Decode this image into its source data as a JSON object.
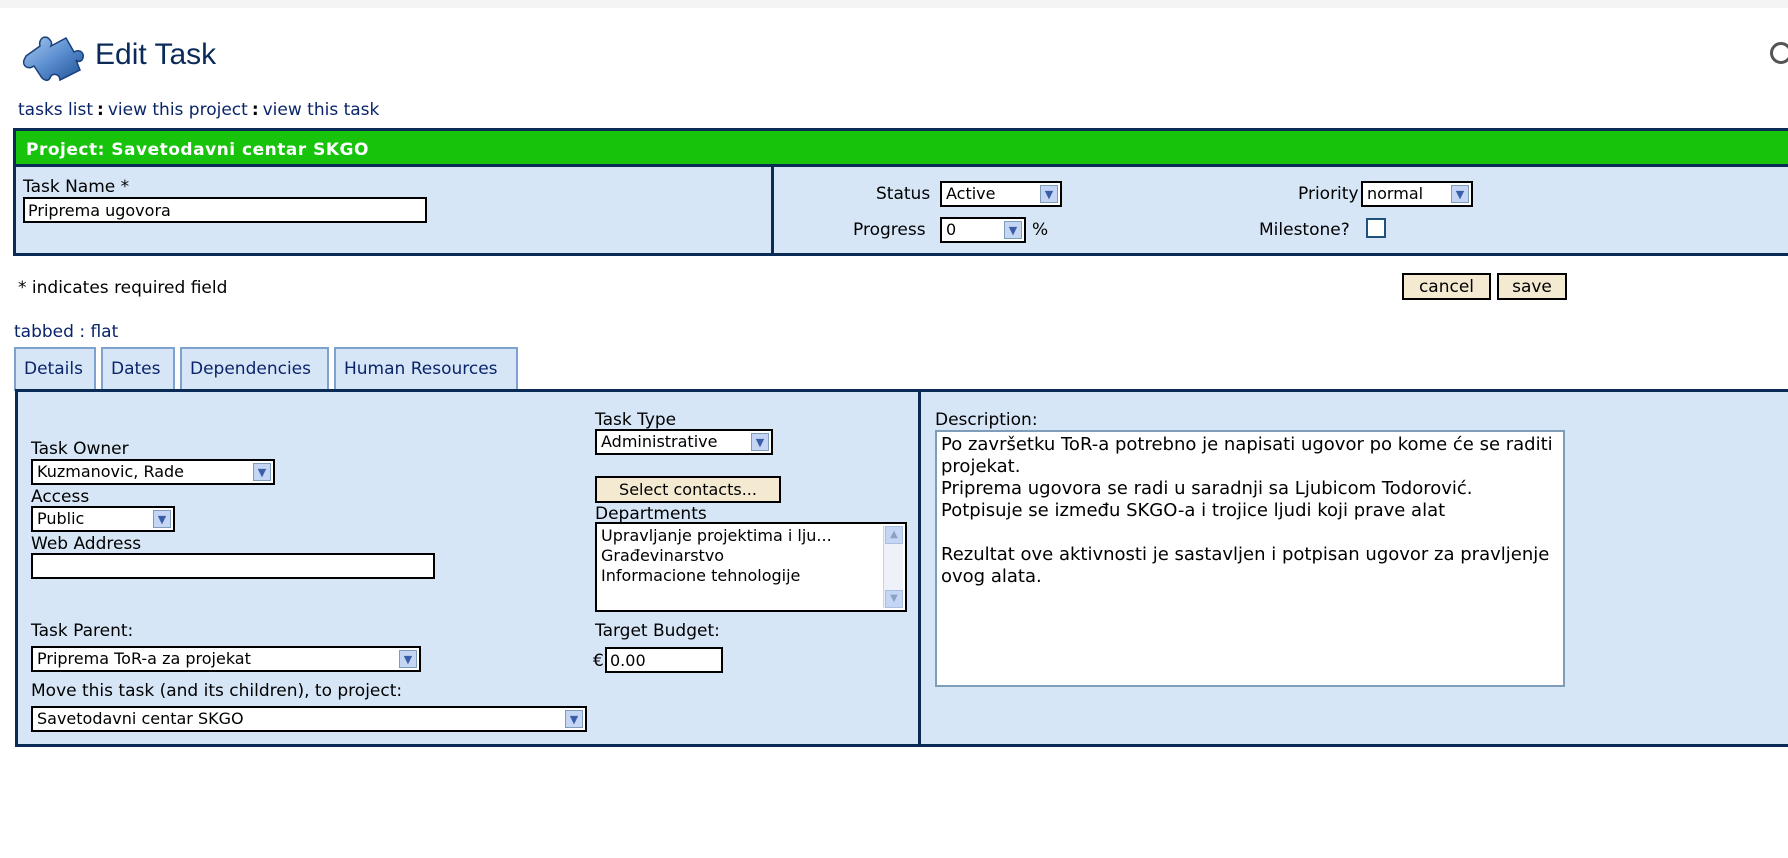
{
  "header": {
    "title": "Edit Task",
    "logo_icon": "puzzle-piece-icon"
  },
  "breadcrumbs": {
    "tasks_list": "tasks list",
    "sep1": ":",
    "view_project": "view this project",
    "sep2": ":",
    "view_task": "view this task"
  },
  "project": {
    "heading": "Project: Savetodavni centar SKGO",
    "task_name_label": "Task Name *",
    "task_name_value": "Priprema ugovora",
    "status_label": "Status",
    "status_value": "Active",
    "priority_label": "Priority *",
    "priority_value": "normal",
    "progress_label": "Progress",
    "progress_value": "0",
    "progress_unit": "%",
    "milestone_label": "Milestone?",
    "milestone_checked": false
  },
  "form": {
    "required_note": "* indicates required field",
    "cancel_label": "cancel",
    "save_label": "save"
  },
  "view_mode": {
    "tabbed": "tabbed",
    "sep": ":",
    "flat": "flat"
  },
  "tabs": [
    {
      "label": "Details",
      "active": true
    },
    {
      "label": "Dates",
      "active": false
    },
    {
      "label": "Dependencies",
      "active": false
    },
    {
      "label": "Human Resources",
      "active": false
    }
  ],
  "details": {
    "task_owner_label": "Task Owner",
    "task_owner_value": "Kuzmanovic, Rade",
    "access_label": "Access",
    "access_value": "Public",
    "web_address_label": "Web Address",
    "web_address_value": "",
    "task_parent_label": "Task Parent:",
    "task_parent_value": "Priprema ToR-a za projekat",
    "move_label": "Move this task (and its children), to project:",
    "move_value": "Savetodavni centar SKGO",
    "task_type_label": "Task Type",
    "task_type_value": "Administrative",
    "select_contacts_label": "Select contacts...",
    "departments_label": "Departments",
    "departments": [
      "Upravljanje projektima i lju...",
      "Građevinarstvo",
      "Informacione tehnologije"
    ],
    "target_budget_label": "Target Budget:",
    "currency_symbol": "€",
    "target_budget_value": "0.00",
    "description_label": "Description:",
    "description_value": "Po završetku ToR-a potrebno je napisati ugovor po kome će se raditi projekat.\nPriprema ugovora se radi u saradnji sa Ljubicom Todorović.\nPotpisuje se između SKGO-a i trojice ljudi koji prave alat\n\nRezultat ove aktivnosti je sastavljen i potpisan ugovor za pravljenje ovog alata."
  }
}
